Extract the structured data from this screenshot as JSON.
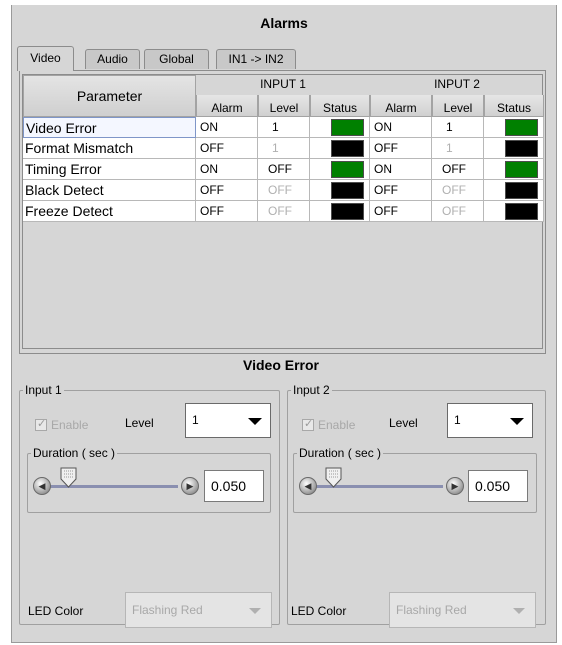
{
  "title": "Alarms",
  "tabs": [
    {
      "label": "Video",
      "active": true
    },
    {
      "label": "Audio",
      "active": false
    },
    {
      "label": "Global",
      "active": false
    },
    {
      "label": "IN1 -> IN2",
      "active": false
    }
  ],
  "table": {
    "param_header": "Parameter",
    "input1_header": "INPUT 1",
    "input2_header": "INPUT 2",
    "sub_headers": {
      "alarm": "Alarm",
      "level": "Level",
      "status": "Status"
    },
    "rows": [
      {
        "name": "Video Error",
        "in1_alarm": "ON",
        "in1_level": "1",
        "in1_level_dim": false,
        "in1_status": "#008000",
        "in2_alarm": "ON",
        "in2_level": "1",
        "in2_level_dim": false,
        "in2_status": "#008000"
      },
      {
        "name": "Format Mismatch",
        "in1_alarm": "OFF",
        "in1_level": "1",
        "in1_level_dim": true,
        "in1_status": "#000000",
        "in2_alarm": "OFF",
        "in2_level": "1",
        "in2_level_dim": true,
        "in2_status": "#000000"
      },
      {
        "name": "Timing Error",
        "in1_alarm": "ON",
        "in1_level": "OFF",
        "in1_level_dim": false,
        "in1_status": "#008000",
        "in2_alarm": "ON",
        "in2_level": "OFF",
        "in2_level_dim": false,
        "in2_status": "#008000"
      },
      {
        "name": "Black Detect",
        "in1_alarm": "OFF",
        "in1_level": "OFF",
        "in1_level_dim": true,
        "in1_status": "#000000",
        "in2_alarm": "OFF",
        "in2_level": "OFF",
        "in2_level_dim": true,
        "in2_status": "#000000"
      },
      {
        "name": "Freeze Detect",
        "in1_alarm": "OFF",
        "in1_level": "OFF",
        "in1_level_dim": true,
        "in1_status": "#000000",
        "in2_alarm": "OFF",
        "in2_level": "OFF",
        "in2_level_dim": true,
        "in2_status": "#000000"
      }
    ]
  },
  "detail": {
    "title": "Video Error",
    "input1": {
      "label": "Input 1",
      "enable_label": "Enable",
      "level_label": "Level",
      "level_value": "1",
      "duration_label": "Duration ( sec )",
      "duration_value": "0.050",
      "led_label": "LED Color",
      "led_value": "Flashing Red"
    },
    "input2": {
      "label": "Input 2",
      "enable_label": "Enable",
      "level_label": "Level",
      "level_value": "1",
      "duration_label": "Duration ( sec )",
      "duration_value": "0.050",
      "led_label": "LED Color",
      "led_value": "Flashing Red"
    }
  },
  "colors": {
    "status_ok": "#008000",
    "status_off": "#000000",
    "panel_bg": "#d6d6d6"
  }
}
